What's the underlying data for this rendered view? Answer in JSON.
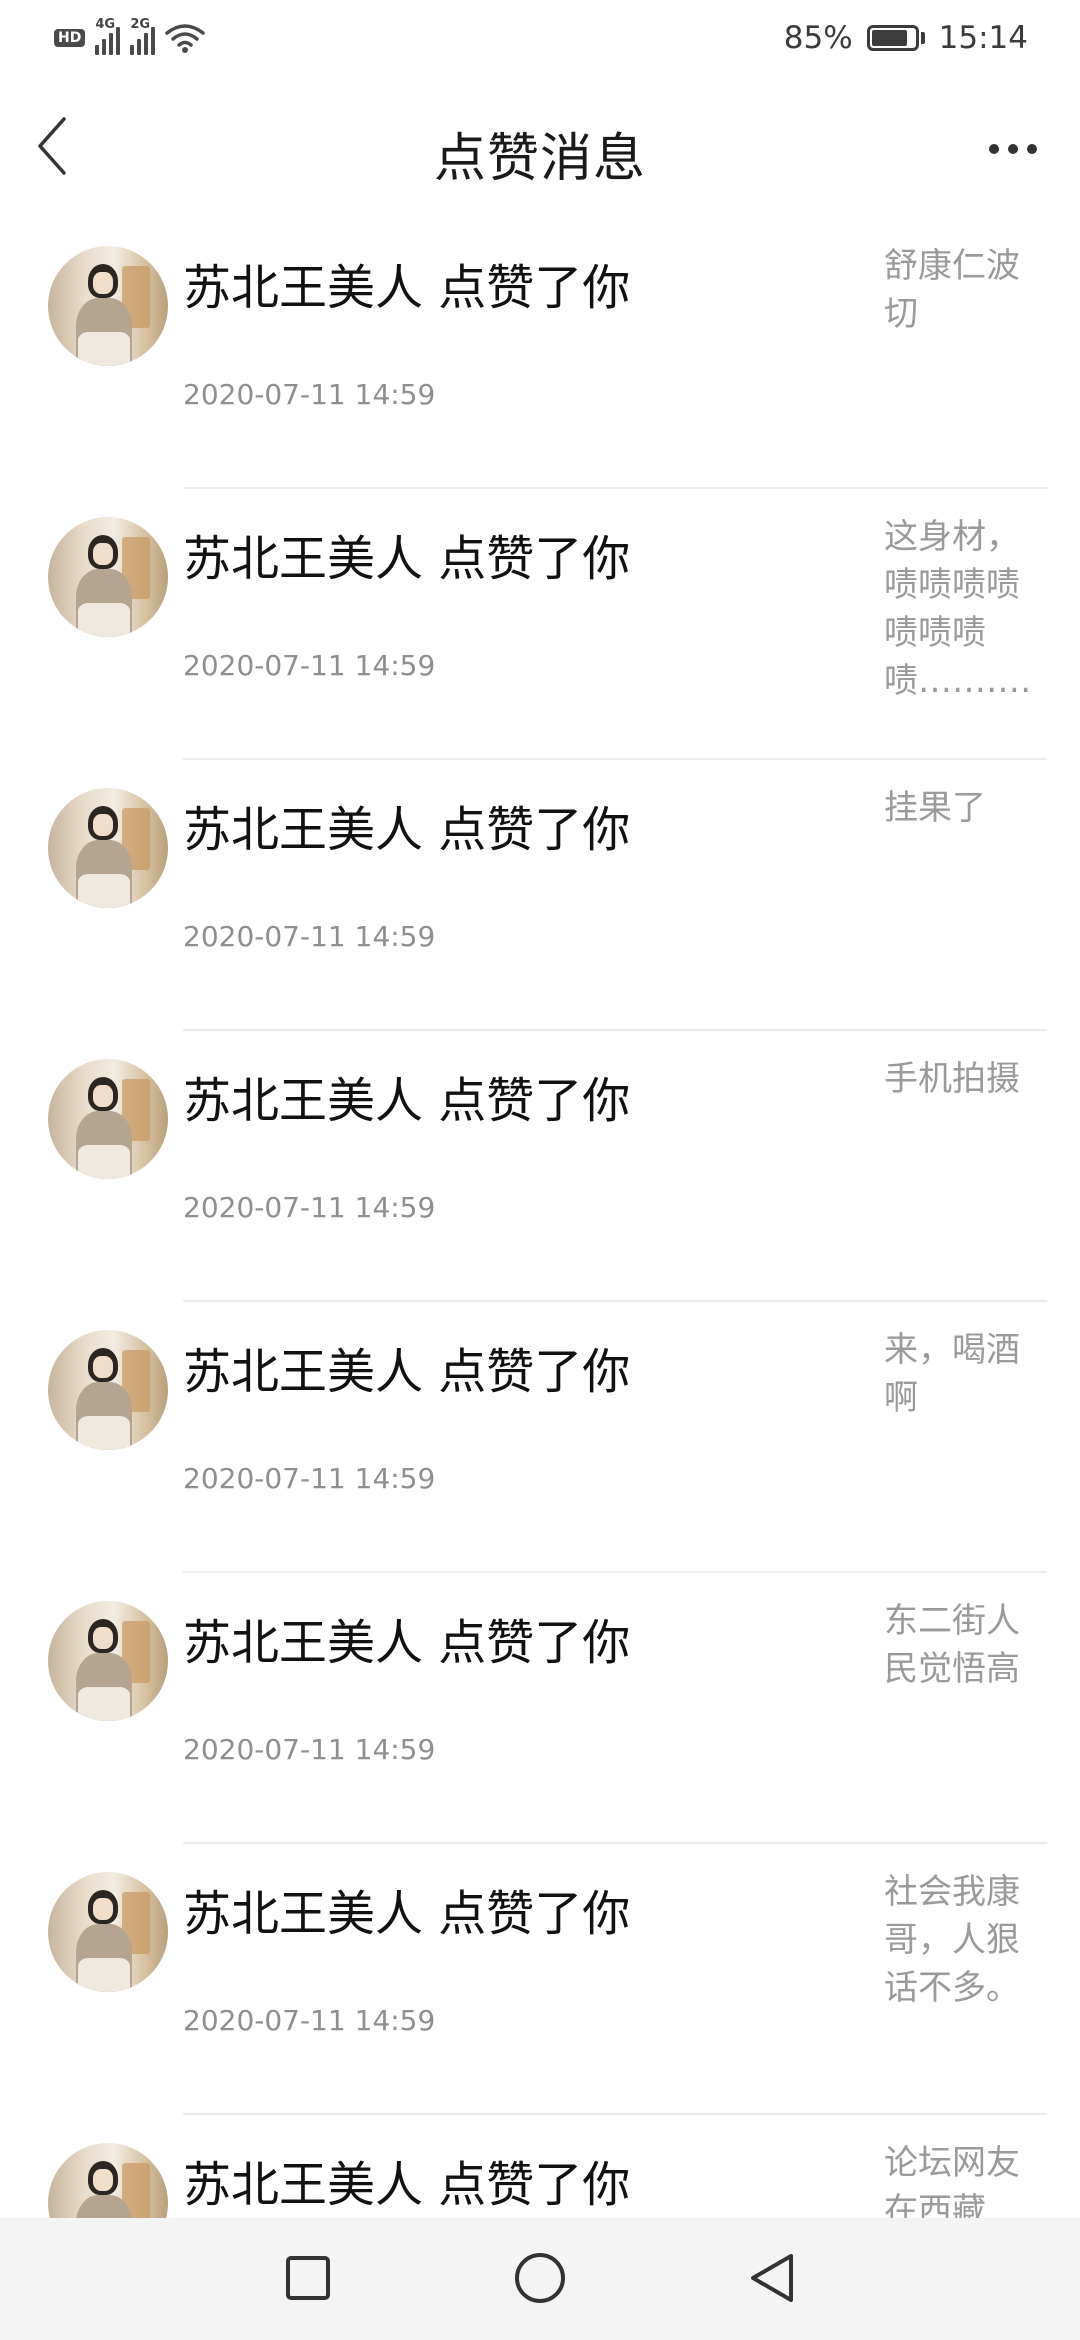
{
  "status_bar": {
    "hd_label": "HD",
    "sim1_label": "4G",
    "sim2_label": "2G",
    "battery_percent": "85%",
    "battery_level": 0.85,
    "time": "15:14"
  },
  "header": {
    "title": "点赞消息"
  },
  "notifications": [
    {
      "title": "苏北王美人 点赞了你",
      "time": "2020-07-11 14:59",
      "preview": "舒康仁波切"
    },
    {
      "title": "苏北王美人 点赞了你",
      "time": "2020-07-11 14:59",
      "preview": "这身材，啧啧啧啧啧啧啧啧…………"
    },
    {
      "title": "苏北王美人 点赞了你",
      "time": "2020-07-11 14:59",
      "preview": "挂果了"
    },
    {
      "title": "苏北王美人 点赞了你",
      "time": "2020-07-11 14:59",
      "preview": "手机拍摄"
    },
    {
      "title": "苏北王美人 点赞了你",
      "time": "2020-07-11 14:59",
      "preview": "来，喝酒啊"
    },
    {
      "title": "苏北王美人 点赞了你",
      "time": "2020-07-11 14:59",
      "preview": "东二街人民觉悟高"
    },
    {
      "title": "苏北王美人 点赞了你",
      "time": "2020-07-11 14:59",
      "preview": "社会我康哥，人狠话不多。"
    },
    {
      "title": "苏北王美人 点赞了你",
      "time": "",
      "preview": "论坛网友在西藏"
    }
  ],
  "icons": {
    "back": "back-arrow-icon",
    "more": "more-dots-icon",
    "nav_recents": "square-icon",
    "nav_home": "circle-icon",
    "nav_back": "triangle-back-icon"
  },
  "colors": {
    "title_text": "#111111",
    "time_text": "#8f8f8f",
    "preview_text": "#9a9a9a",
    "divider": "#ececec",
    "nav_bg": "#f4f4f4"
  }
}
